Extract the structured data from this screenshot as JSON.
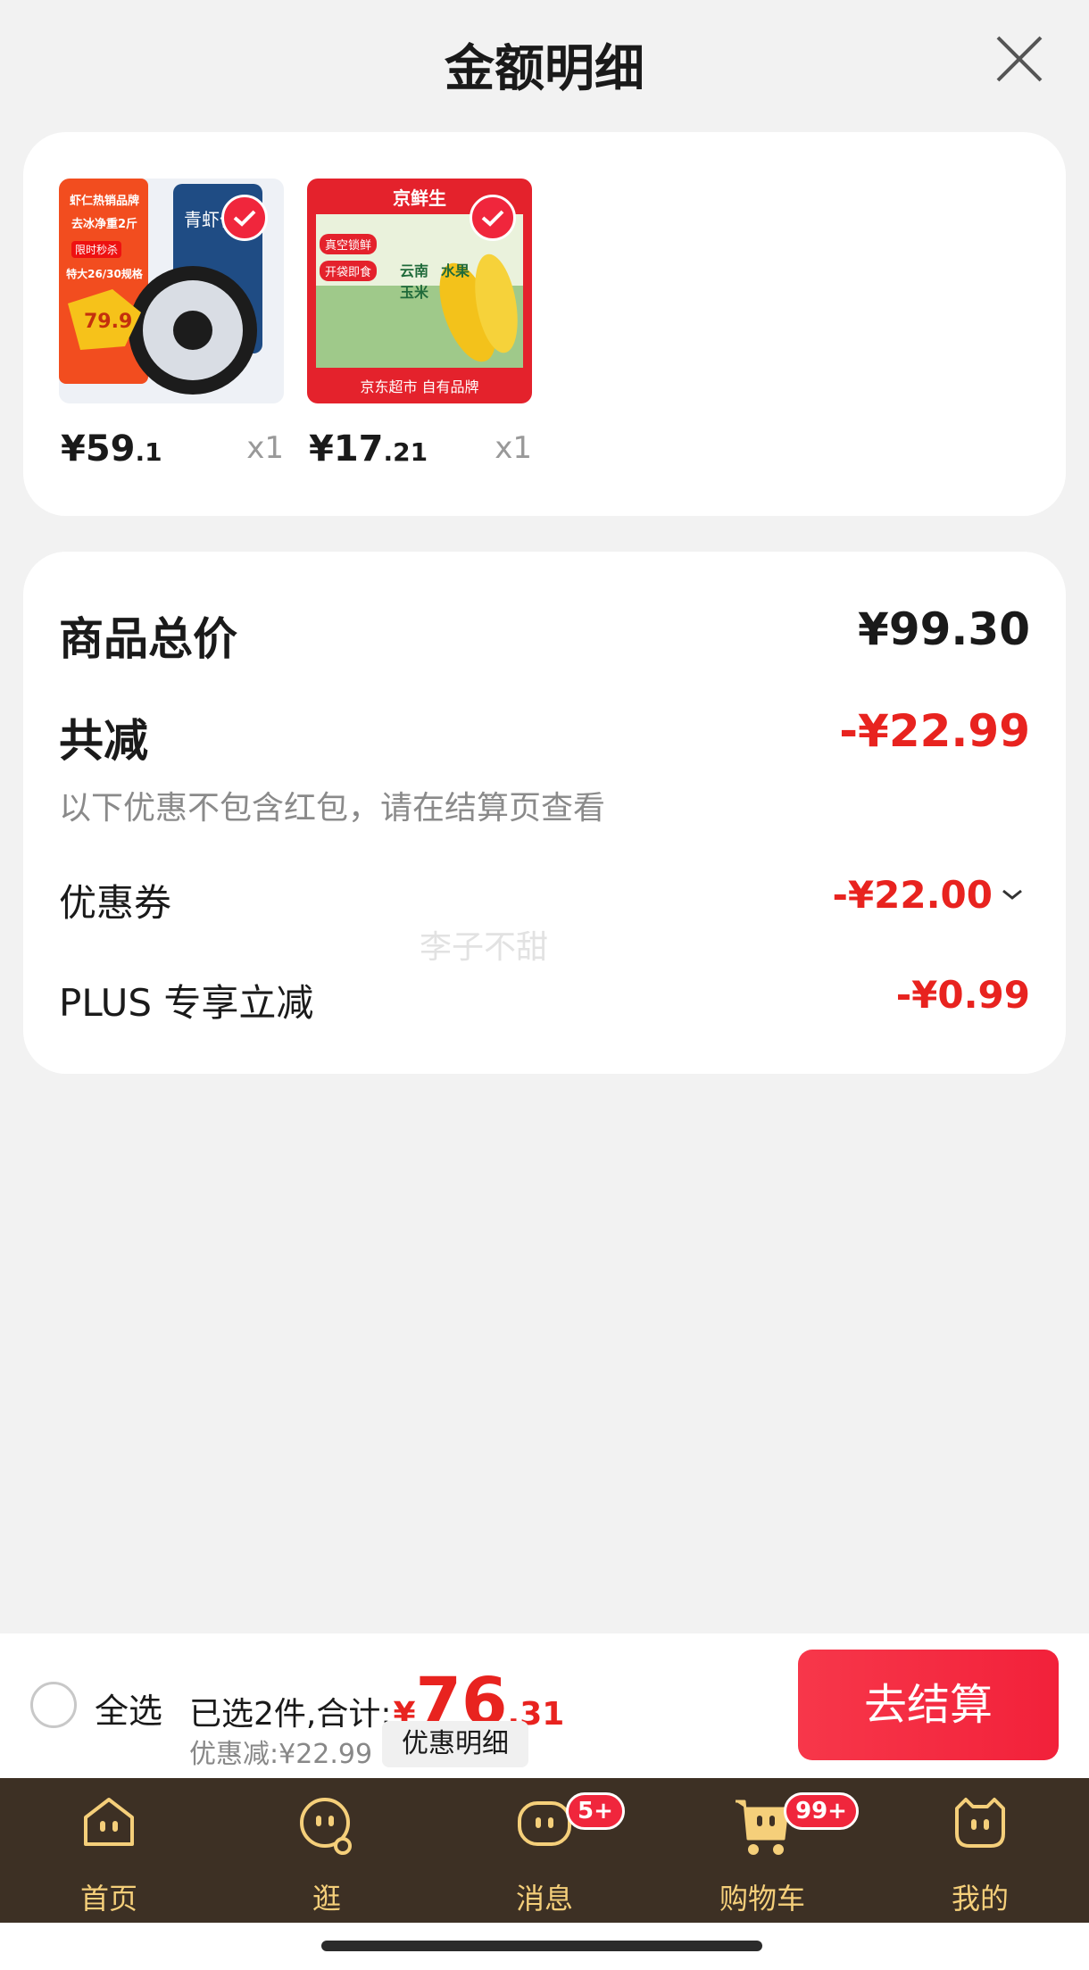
{
  "header": {
    "title": "金额明细"
  },
  "products": [
    {
      "price_int": "¥59",
      "price_dec": ".1",
      "qty": "x1",
      "thumb_texts": [
        "虾仁热销品牌",
        "去冰净重2斤",
        "限时秒杀",
        "特大26/30规格",
        "79.9",
        "青虾仁"
      ]
    },
    {
      "price_int": "¥17",
      "price_dec": ".21",
      "qty": "x1",
      "thumb_texts": [
        "京鲜生",
        "真空锁鲜",
        "开袋即食",
        "云南",
        "水果",
        "玉米",
        "京东超市 自有品牌"
      ]
    }
  ],
  "summary": {
    "total_label": "商品总价",
    "total_value": "¥99.30",
    "reduce_label": "共减",
    "reduce_value": "-¥22.99",
    "note": "以下优惠不包含红包，请在结算页查看",
    "coupon_label": "优惠券",
    "coupon_value": "-¥22.00",
    "plus_label": "PLUS 专享立减",
    "plus_value": "-¥0.99"
  },
  "watermark": "李子不甜",
  "bottom": {
    "select_all": "全选",
    "selected_prefix": "已选2件,合计:",
    "total_symbol": "¥",
    "total_int": "76",
    "total_dec": ".31",
    "discount": "优惠减:¥22.99",
    "detail_button": "优惠明细",
    "checkout": "去结算"
  },
  "tabs": [
    {
      "label": "首页",
      "icon": "home-face-icon"
    },
    {
      "label": "逛",
      "icon": "browse-face-icon"
    },
    {
      "label": "消息",
      "icon": "message-face-icon",
      "badge": "5+"
    },
    {
      "label": "购物车",
      "icon": "cart-icon",
      "badge": "99+"
    },
    {
      "label": "我的",
      "icon": "profile-face-icon"
    }
  ],
  "colors": {
    "accent_red": "#e8231f",
    "tabbar_bg": "#3d3024",
    "tab_gold": "#f5cf7a"
  }
}
